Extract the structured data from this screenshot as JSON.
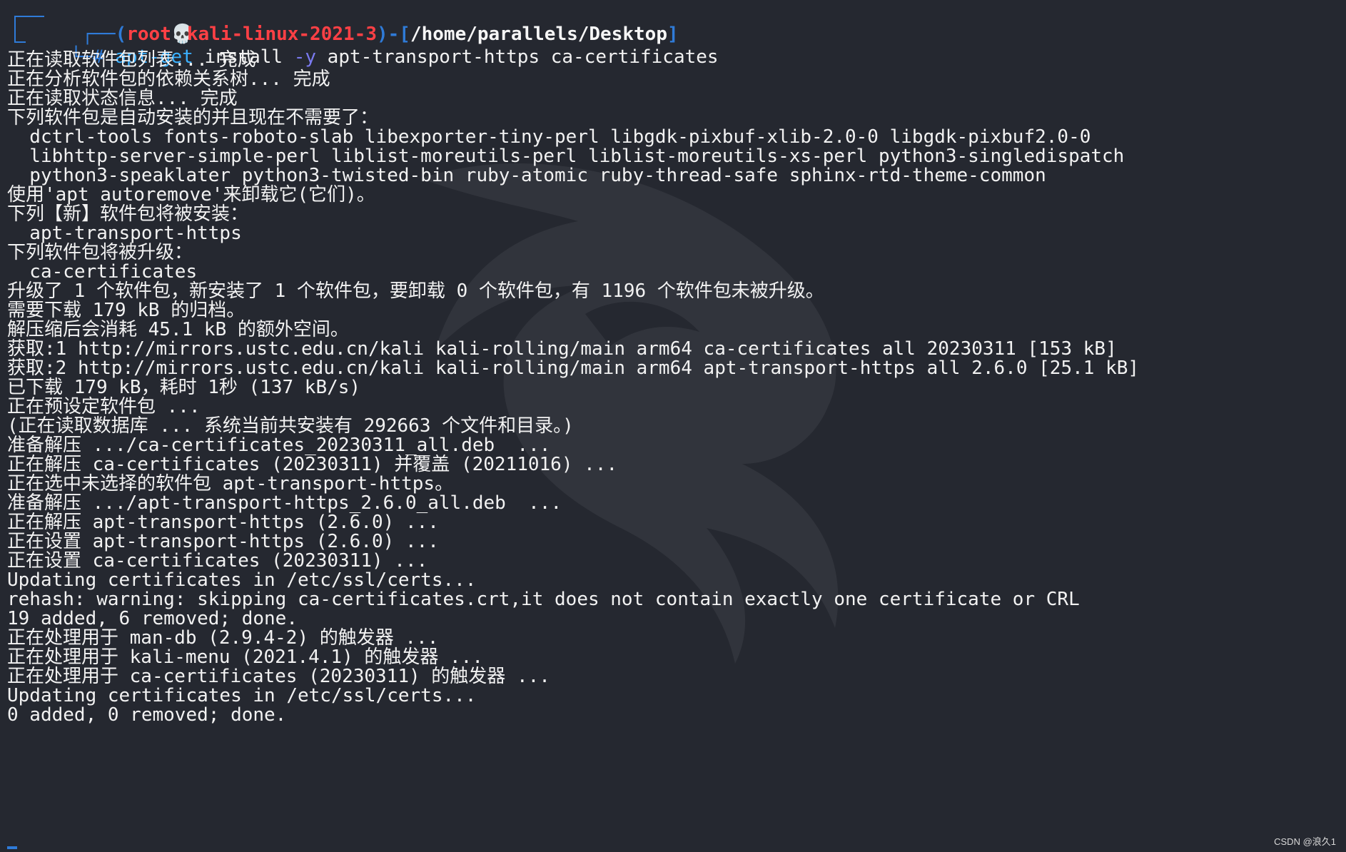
{
  "prompt": {
    "open": "┌──(",
    "user": "root",
    "skull": "💀",
    "host": "kali-linux-2021-3",
    "mid": ")-[",
    "path": "/home/parallels/Desktop",
    "close": "]",
    "hash": "└─#",
    "command": "apt-get",
    "args_1": " install ",
    "flag": "-y",
    "args_2": " apt-transport-https ca-certificates"
  },
  "output_lines": [
    "正在读取软件包列表... 完成",
    "正在分析软件包的依赖关系树... 完成",
    "正在读取状态信息... 完成",
    "下列软件包是自动安装的并且现在不需要了：",
    "  dctrl-tools fonts-roboto-slab libexporter-tiny-perl libgdk-pixbuf-xlib-2.0-0 libgdk-pixbuf2.0-0",
    "  libhttp-server-simple-perl liblist-moreutils-perl liblist-moreutils-xs-perl python3-singledispatch",
    "  python3-speaklater python3-twisted-bin ruby-atomic ruby-thread-safe sphinx-rtd-theme-common",
    "使用'apt autoremove'来卸载它(它们)。",
    "下列【新】软件包将被安装：",
    "  apt-transport-https",
    "下列软件包将被升级：",
    "  ca-certificates",
    "升级了 1 个软件包，新安装了 1 个软件包，要卸载 0 个软件包，有 1196 个软件包未被升级。",
    "需要下载 179 kB 的归档。",
    "解压缩后会消耗 45.1 kB 的额外空间。",
    "获取:1 http://mirrors.ustc.edu.cn/kali kali-rolling/main arm64 ca-certificates all 20230311 [153 kB]",
    "获取:2 http://mirrors.ustc.edu.cn/kali kali-rolling/main arm64 apt-transport-https all 2.6.0 [25.1 kB]",
    "已下载 179 kB，耗时 1秒 (137 kB/s)",
    "正在预设定软件包 ...",
    "(正在读取数据库 ... 系统当前共安装有 292663 个文件和目录。)",
    "准备解压 .../ca-certificates_20230311_all.deb  ...",
    "正在解压 ca-certificates (20230311) 并覆盖 (20211016) ...",
    "正在选中未选择的软件包 apt-transport-https。",
    "准备解压 .../apt-transport-https_2.6.0_all.deb  ...",
    "正在解压 apt-transport-https (2.6.0) ...",
    "正在设置 apt-transport-https (2.6.0) ...",
    "正在设置 ca-certificates (20230311) ...",
    "Updating certificates in /etc/ssl/certs...",
    "rehash: warning: skipping ca-certificates.crt,it does not contain exactly one certificate or CRL",
    "19 added, 6 removed; done.",
    "正在处理用于 man-db (2.9.4-2) 的触发器 ...",
    "正在处理用于 kali-menu (2021.4.1) 的触发器 ...",
    "正在处理用于 ca-certificates (20230311) 的触发器 ...",
    "Updating certificates in /etc/ssl/certs...",
    "0 added, 0 removed; done."
  ],
  "watermark": "CSDN @浪久1",
  "colors": {
    "background": "#252830",
    "text": "#f2f2f2",
    "prompt_blue": "#2f7bd8",
    "prompt_red": "#ff4045",
    "command_blue": "#3bb1ff",
    "flag_purple": "#7a7af0"
  },
  "icons": {
    "skull": "skull-icon",
    "background_logo": "kali-dragon-icon"
  }
}
